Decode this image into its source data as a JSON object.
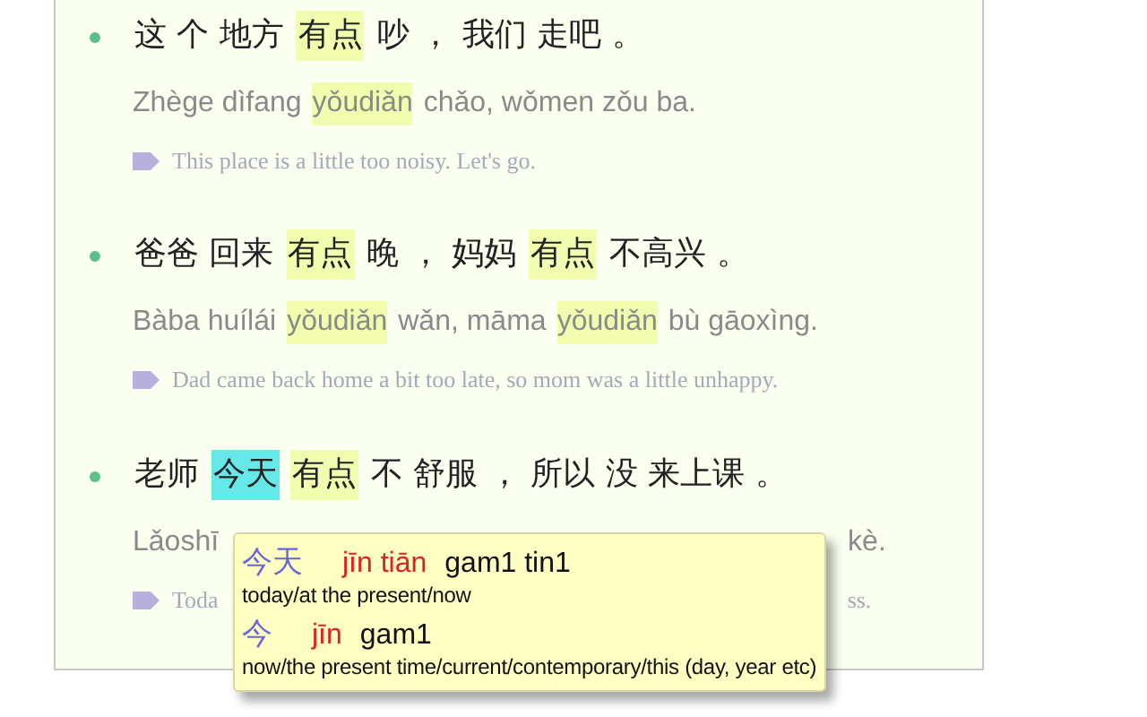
{
  "sentences": [
    {
      "hanzi": [
        {
          "text": "这 个 地方",
          "highlighted": false,
          "selected": false
        },
        {
          "text": "有点",
          "highlighted": true,
          "selected": false
        },
        {
          "text": "吵 ， 我们 走吧 。",
          "highlighted": false,
          "selected": false
        }
      ],
      "pinyin": [
        {
          "text": "Zhège dìfang",
          "highlighted": false
        },
        {
          "text": "yǒudiǎn",
          "highlighted": true
        },
        {
          "text": "chǎo, wǒmen zǒu ba.",
          "highlighted": false
        }
      ],
      "translation": [
        "This place is a little too noisy. Let's go."
      ]
    },
    {
      "hanzi": [
        {
          "text": "爸爸 回来",
          "highlighted": false,
          "selected": false
        },
        {
          "text": "有点",
          "highlighted": true,
          "selected": false
        },
        {
          "text": "晚 ， 妈妈",
          "highlighted": false,
          "selected": false
        },
        {
          "text": "有点",
          "highlighted": true,
          "selected": false
        },
        {
          "text": "不高兴 。",
          "highlighted": false,
          "selected": false
        }
      ],
      "pinyin": [
        {
          "text": "Bàba huílái",
          "highlighted": false
        },
        {
          "text": "yǒudiǎn",
          "highlighted": true
        },
        {
          "text": "wǎn, māma",
          "highlighted": false
        },
        {
          "text": "yǒudiǎn",
          "highlighted": true
        },
        {
          "text": "bù gāoxìng.",
          "highlighted": false
        }
      ],
      "translation": [
        "Dad came back home a bit too late, so mom was a little unhappy."
      ]
    },
    {
      "hanzi": [
        {
          "text": "老师",
          "highlighted": false,
          "selected": false
        },
        {
          "text": "今天",
          "highlighted": false,
          "selected": true
        },
        {
          "text": "有点",
          "highlighted": true,
          "selected": false
        },
        {
          "text": "不 舒服 ， 所以 没 来上课 。",
          "highlighted": false,
          "selected": false
        }
      ],
      "pinyin": [
        {
          "text": "Lǎoshī",
          "highlighted": false
        },
        {
          "text": "kè.",
          "highlighted": false
        }
      ],
      "translation": [
        "Toda",
        "ss."
      ]
    }
  ],
  "popup": {
    "entries": [
      {
        "hanzi": "今天",
        "pinyin": "jīn tiān",
        "jyutping": "gam1 tin1",
        "definition": "today/at the present/now"
      },
      {
        "hanzi": "今",
        "pinyin": "jīn",
        "jyutping": "gam1",
        "definition": "now/the present time/current/contemporary/this (day, year etc)"
      }
    ]
  }
}
